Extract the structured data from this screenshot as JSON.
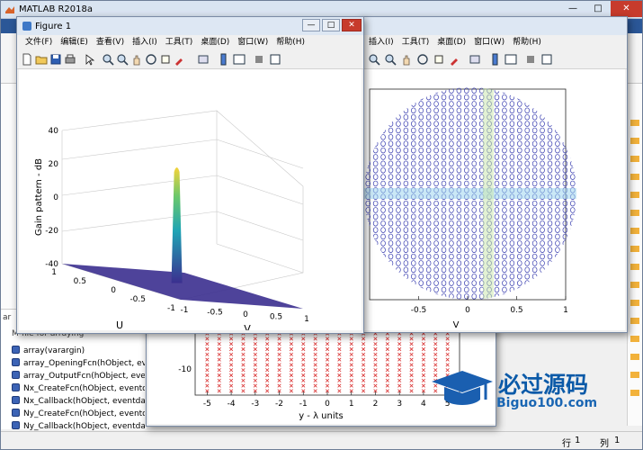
{
  "app": {
    "title": "MATLAB R2018a",
    "window_min_glyph": "—",
    "window_max_glyph": "□",
    "window_close_glyph": "✕"
  },
  "workspace": {
    "header": "ar",
    "subheader": "M-file for arraying",
    "items": [
      "array(varargin)",
      "array_OpeningFcn(hObject, eventdata...",
      "array_OutputFcn(hObject, eventdata...",
      "Nx_CreateFcn(hObject, eventdata...",
      "Nx_Callback(hObject, eventdata...",
      "Ny_CreateFcn(hObject, eventdata...",
      "Ny_Callback(hObject, eventdata..."
    ]
  },
  "status": {
    "row_label": "行",
    "row_value": "1",
    "col_label": "列",
    "col_value": "1"
  },
  "figure1": {
    "title": "Figure 1",
    "menu": [
      "文件(F)",
      "编辑(E)",
      "查看(V)",
      "插入(I)",
      "工具(T)",
      "桌面(D)",
      "窗口(W)",
      "帮助(H)"
    ]
  },
  "figure2": {
    "menu": [
      "插入(I)",
      "工具(T)",
      "桌面(D)",
      "窗口(W)",
      "帮助(H)"
    ]
  },
  "watermark": {
    "title": "必过源码",
    "url": "Biguo100.com"
  },
  "colors": {
    "surface_low": "#3b2f8f",
    "surface_mid": "#1fa4b5",
    "surface_high": "#f5d33a",
    "contour": "#3a3fb0",
    "marker": "#d93030",
    "close": "#c73b2c"
  },
  "chart_data": [
    {
      "type": "surface",
      "zlabel": "Gain pattern - dB",
      "xlabel": "U",
      "ylabel": "V",
      "z_ticks": [
        "40",
        "20",
        "0",
        "-20",
        "-40"
      ],
      "u_ticks": [
        "1",
        "0.5",
        "0",
        "-0.5",
        "-1"
      ],
      "v_ticks": [
        "-1",
        "-0.5",
        "0",
        "0.5",
        "1"
      ],
      "zlim": [
        -40,
        40
      ],
      "xlim": [
        -1,
        1
      ],
      "ylim": [
        -1,
        1
      ],
      "peak_db": 30
    },
    {
      "type": "contour",
      "xlabel": "V",
      "x_ticks": [
        "-0.5",
        "0",
        "0.5",
        "1"
      ],
      "xlim": [
        -1,
        1
      ]
    },
    {
      "type": "scatter",
      "xlabel": "y - λ units",
      "x_ticks": [
        "-5",
        "-4",
        "-3",
        "-2",
        "-1",
        "0",
        "1",
        "2",
        "3",
        "4",
        "5"
      ],
      "y_ticks": [
        "-10"
      ],
      "xlim": [
        -5.5,
        5.5
      ],
      "marker": "x"
    }
  ]
}
